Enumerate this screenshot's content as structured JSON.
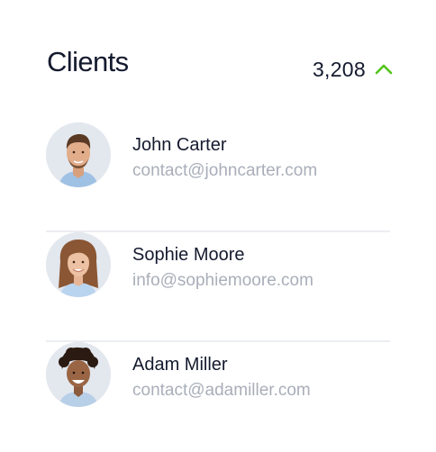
{
  "header": {
    "title": "Clients",
    "count": "3,208",
    "trend_icon": "chevron-up-icon",
    "trend_color": "#52c41a"
  },
  "clients": [
    {
      "name": "John Carter",
      "email": "contact@johncarter.com",
      "avatar_icon": "avatar-john-carter"
    },
    {
      "name": "Sophie Moore",
      "email": "info@sophiemoore.com",
      "avatar_icon": "avatar-sophie-moore"
    },
    {
      "name": "Adam Miller",
      "email": "contact@adamiller.com",
      "avatar_icon": "avatar-adam-miller"
    }
  ],
  "colors": {
    "text_primary": "#141a2e",
    "text_secondary": "#a9aeb9",
    "divider": "#ebedf1",
    "avatar_bg": "#e3e7ee"
  }
}
